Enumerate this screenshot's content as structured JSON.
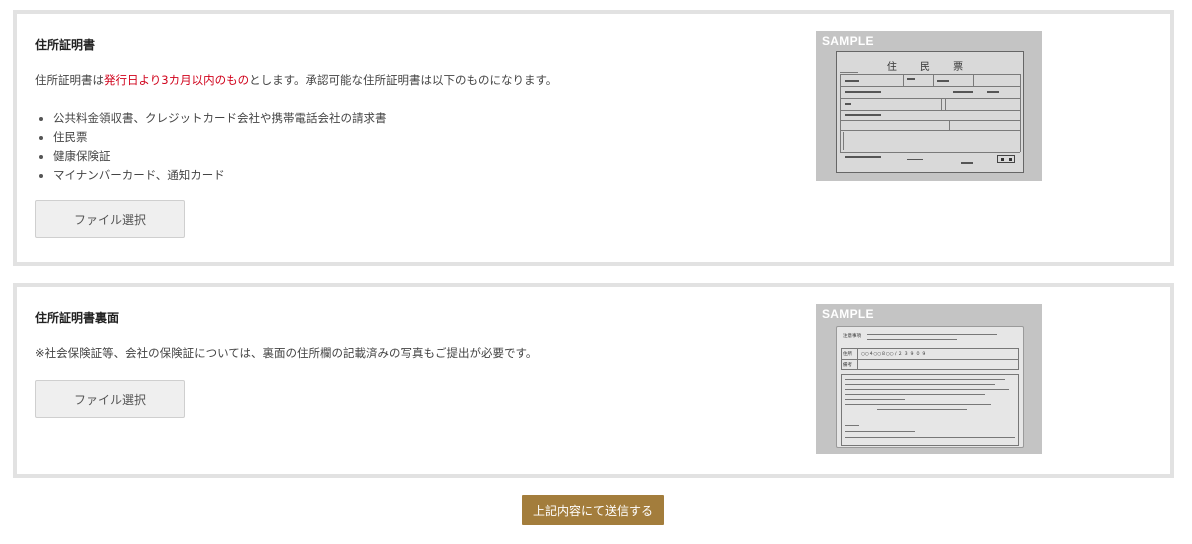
{
  "sections": [
    {
      "title": "住所証明書",
      "desc_prefix": "住所証明書は",
      "desc_highlight": "発行日より3カ月以内のもの",
      "desc_suffix": "とします。承認可能な住所証明書は以下のものになります。",
      "items": [
        "公共料金領収書、クレジットカード会社や携帯電話会社の請求書",
        "住民票",
        "健康保険証",
        "マイナンバーカード、通知カード"
      ],
      "file_button_label": "ファイル選択",
      "sample_label": "SAMPLE",
      "sample_doc_title": "住 民 票"
    },
    {
      "title": "住所証明書裏面",
      "desc": "※社会保険証等、会社の保険証については、裏面の住所欄の記載済みの写真もご提出が必要です。",
      "file_button_label": "ファイル選択",
      "sample_label": "SAMPLE",
      "sample_doc": {
        "heading": "注意事項",
        "address_label": "住所",
        "address_value": "○○４○○８○○ / ２ ３ ９ ０ ９",
        "remarks_label": "備考"
      }
    }
  ],
  "submit_label": "上記内容にて送信する",
  "colors": {
    "highlight": "#d0021b",
    "submit_bg": "#a37d3c",
    "panel_border": "#e2e2e2"
  }
}
